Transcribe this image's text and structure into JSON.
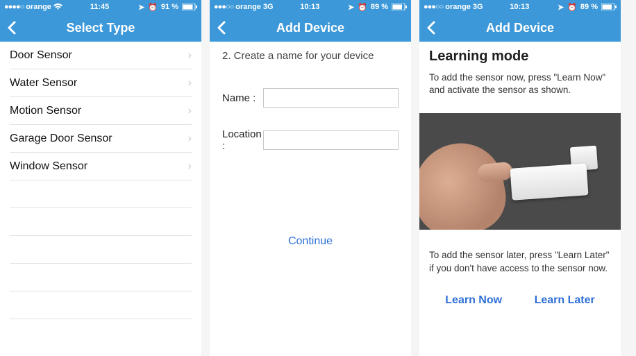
{
  "screens": [
    {
      "status": {
        "dots": "●●●●○",
        "carrier": "orange",
        "net": "",
        "wifi": true,
        "time": "11:45",
        "loc": "➤",
        "alarm": "⏰",
        "pct": "91 %"
      },
      "nav": {
        "title": "Select Type"
      },
      "list": [
        {
          "label": "Door Sensor"
        },
        {
          "label": "Water Sensor"
        },
        {
          "label": "Motion Sensor"
        },
        {
          "label": "Garage Door Sensor"
        },
        {
          "label": "Window Sensor"
        }
      ]
    },
    {
      "status": {
        "dots": "●●●○○",
        "carrier": "orange",
        "net": "3G",
        "wifi": false,
        "time": "10:13",
        "loc": "➤",
        "alarm": "⏰",
        "pct": "89 %"
      },
      "nav": {
        "title": "Add Device"
      },
      "instruction": "2. Create a name for your device",
      "form": {
        "nameLabel": "Name :",
        "nameValue": "",
        "locLabel": "Location :",
        "locValue": ""
      },
      "continue": "Continue"
    },
    {
      "status": {
        "dots": "●●●○○",
        "carrier": "orange",
        "net": "3G",
        "wifi": false,
        "time": "10:13",
        "loc": "➤",
        "alarm": "⏰",
        "pct": "89 %"
      },
      "nav": {
        "title": "Add Device"
      },
      "lm": {
        "title": "Learning mode",
        "p1": "To add the sensor now, press \"Learn Now\" and activate the sensor as shown.",
        "p2": "To add the sensor later, press \"Learn Later\" if you don't have access to the sensor now.",
        "btnNow": "Learn Now",
        "btnLater": "Learn Later"
      }
    }
  ]
}
